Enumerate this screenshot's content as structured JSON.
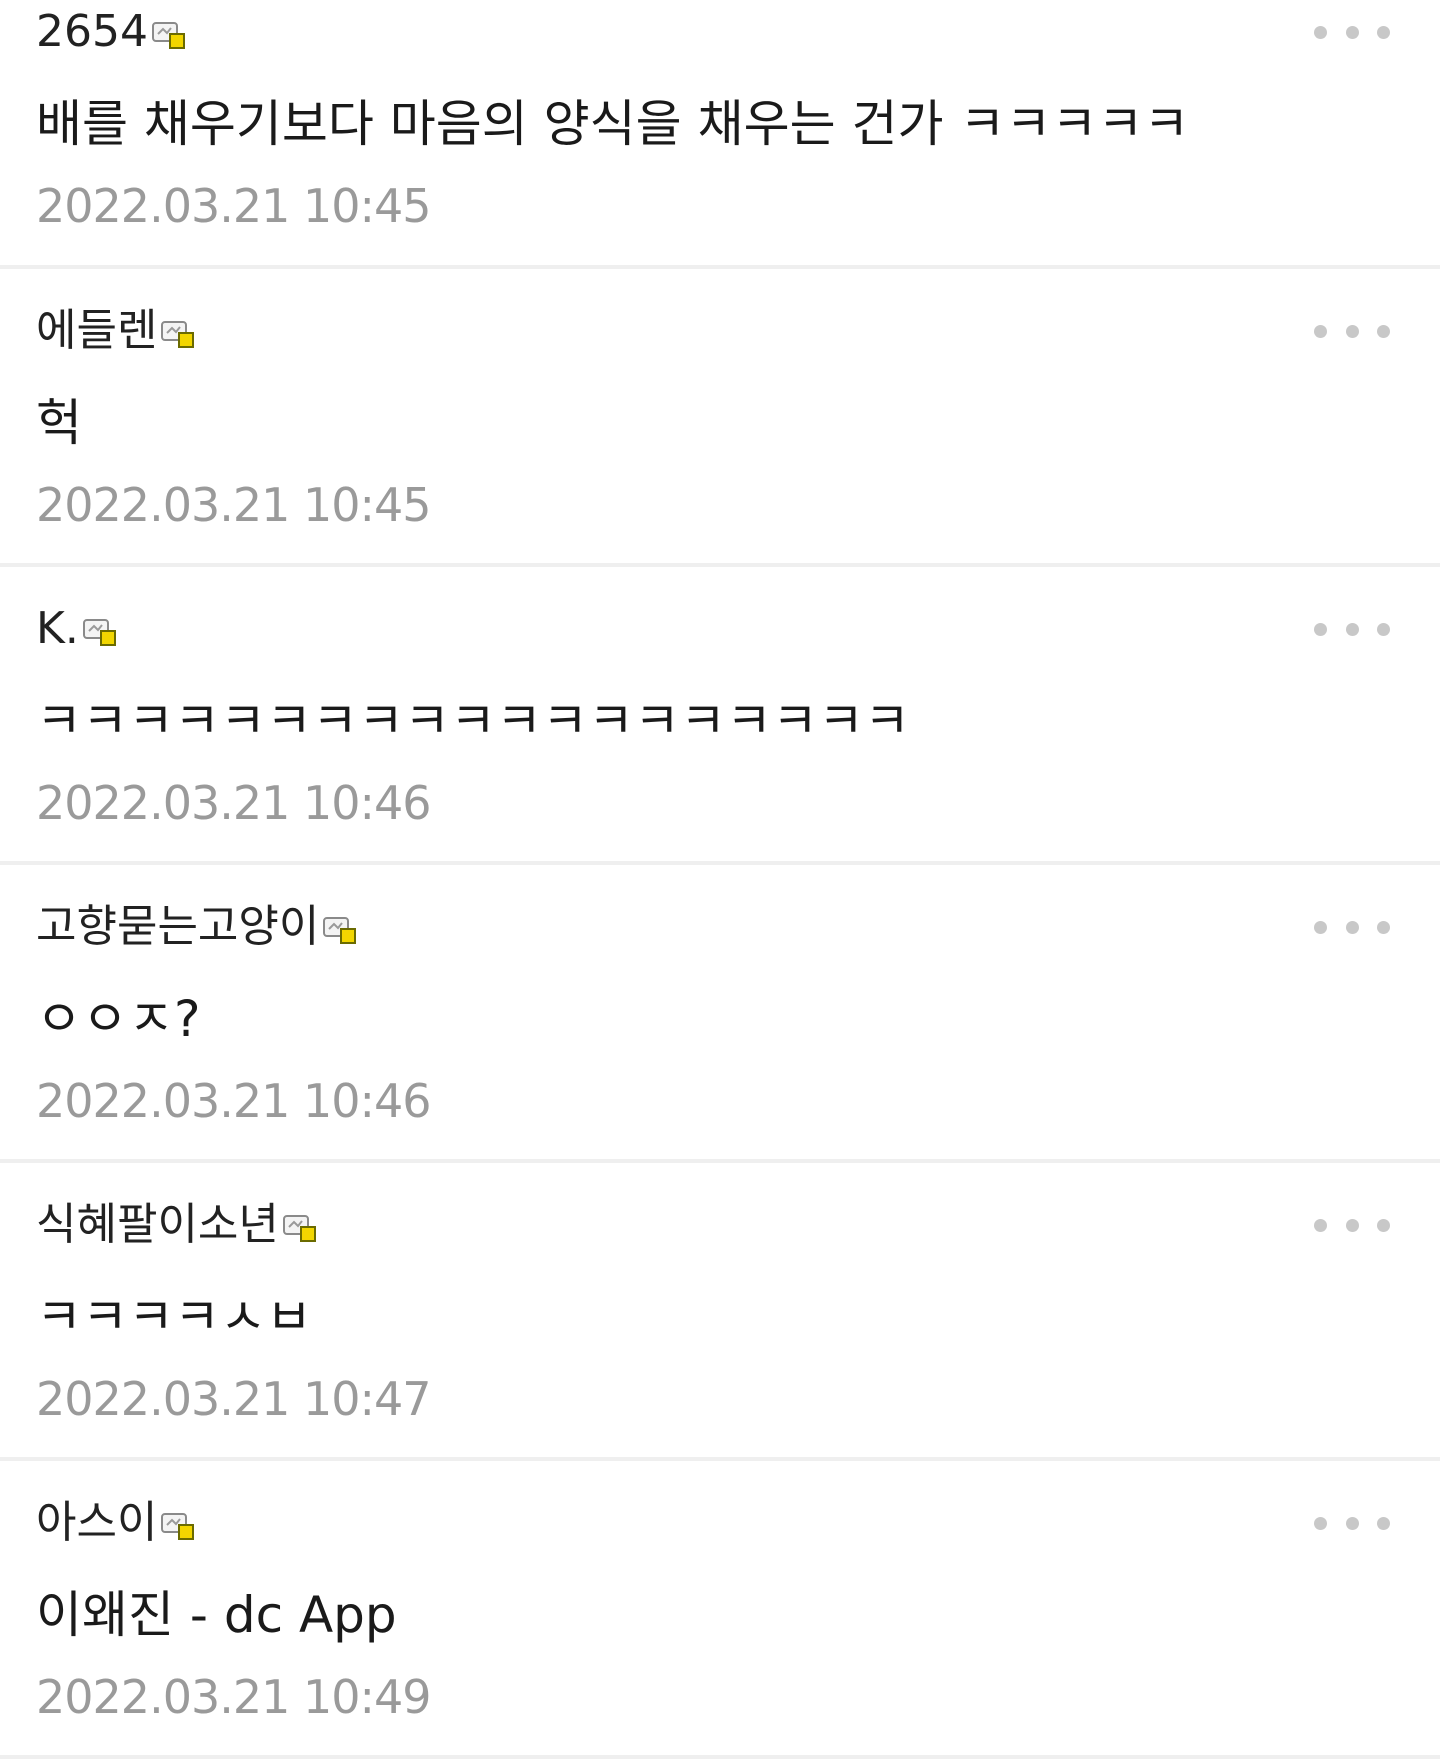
{
  "comments": [
    {
      "nickname": "2654",
      "badge_icon": "user-badge-icon",
      "text": "배를 채우기보다 마음의 양식을 채우는 건가 ㅋㅋㅋㅋㅋ",
      "time": "2022.03.21 10:45"
    },
    {
      "nickname": "에들렌",
      "badge_icon": "user-badge-icon",
      "text": "헉",
      "time": "2022.03.21 10:45"
    },
    {
      "nickname": "K.",
      "badge_icon": "user-badge-icon",
      "text": "ㅋㅋㅋㅋㅋㅋㅋㅋㅋㅋㅋㅋㅋㅋㅋㅋㅋㅋㅋ",
      "time": "2022.03.21 10:46"
    },
    {
      "nickname": "고향묻는고양이",
      "badge_icon": "user-badge-icon",
      "text": "ㅇㅇㅈ?",
      "time": "2022.03.21 10:46"
    },
    {
      "nickname": "식혜팔이소년",
      "badge_icon": "user-badge-icon",
      "text": "ㅋㅋㅋㅋㅅㅂ",
      "time": "2022.03.21 10:47"
    },
    {
      "nickname": "아스이",
      "badge_icon": "user-badge-icon",
      "text": "이왜진 - dc App",
      "time": "2022.03.21 10:49"
    }
  ],
  "more_icon": "more-dots-icon",
  "colors": {
    "timestamp": "#9a9a9a",
    "divider": "#efefef",
    "dots": "#c8c8c8",
    "badge_yellow": "#f2d600"
  }
}
